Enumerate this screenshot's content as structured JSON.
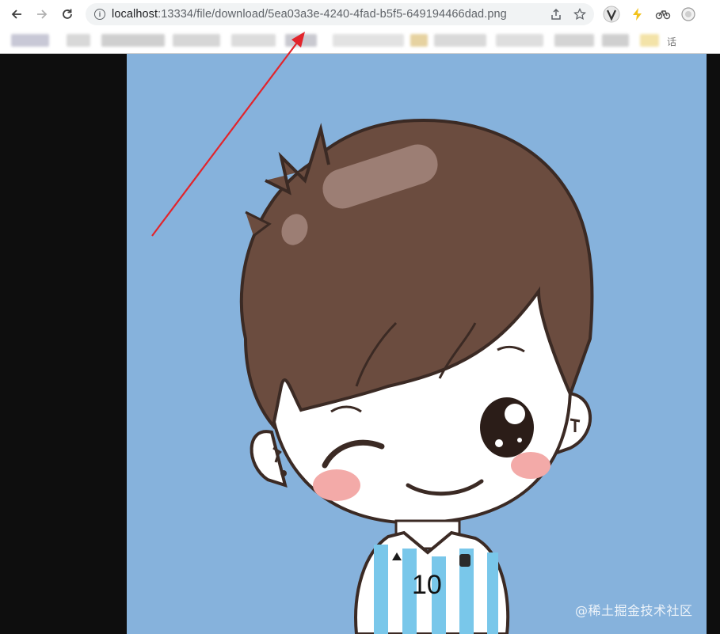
{
  "browser": {
    "url_host": "localhost",
    "url_path": ":13334/file/download/5ea03a3e-4240-4fad-b5f5-649194466dad.png",
    "bookmark_fragment": "话"
  },
  "image": {
    "jersey_number": "10",
    "watermark": "@稀土掘金技术社区"
  },
  "colors": {
    "background": "#86b2dc",
    "hair": "#6b4c3f",
    "skin": "#ffffff",
    "blush": "#f3aaa8",
    "jersey_blue": "#79c7ea",
    "arrow": "#e2242b"
  },
  "icons": [
    "back-icon",
    "forward-icon",
    "reload-icon",
    "info-icon",
    "share-icon",
    "star-icon",
    "v-extension-icon",
    "lightning-icon",
    "bike-icon",
    "profile-icon"
  ]
}
